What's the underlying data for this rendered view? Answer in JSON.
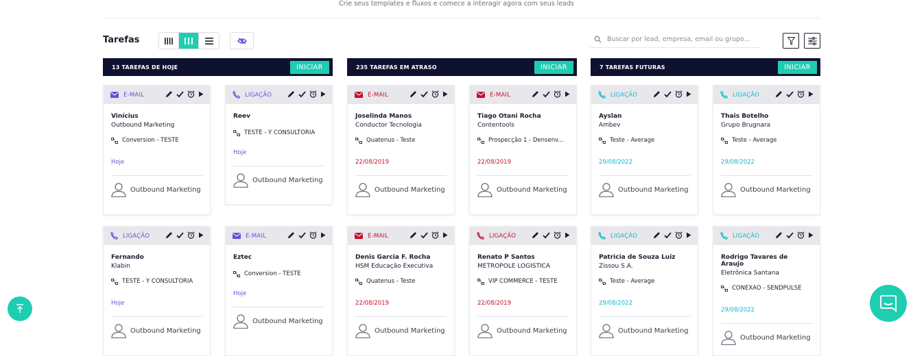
{
  "subtitle": "Crie seus templates e fluxos e comece a interagir agora com seus leads",
  "toolbar": {
    "title": "Tarefas",
    "search_placeholder": "Buscar por lead, empresa, email ou grupo..."
  },
  "colors": {
    "accent": "#1fcdb1",
    "header_bg": "#0f1130",
    "email": "#6a4fd7",
    "overdue": "#c8102e",
    "future": "#12b8c9"
  },
  "columns": [
    {
      "count_label": "13  TAREFAS DE HOJE",
      "start_label": "INICIAR"
    },
    {
      "count_label": "235  TAREFAS EM ATRASO",
      "start_label": "INICIAR"
    },
    {
      "count_label": "7  TAREFAS FUTURAS",
      "start_label": "INICIAR"
    }
  ],
  "cards": [
    {
      "type": "E-MAIL",
      "icon": "mail-icon",
      "lead": "Vinícius",
      "company": "Outbound Marketing",
      "flow": "Conversion - TESTE",
      "due": "Hoje",
      "owner": "Outbound Marketing"
    },
    {
      "type": "LIGAÇÃO",
      "icon": "phone-icon",
      "lead": "Reev",
      "company": "",
      "flow": "TESTE - Y CONSULTORIA",
      "due": "Hoje",
      "owner": "Outbound Marketing"
    },
    {
      "type": "E-MAIL",
      "icon": "mail-icon",
      "lead": "Joselinda Manos",
      "company": "Conductor Tecnologia",
      "flow": "Quatenus - Teste",
      "due": "22/08/2019",
      "owner": "Outbound Marketing"
    },
    {
      "type": "E-MAIL",
      "icon": "mail-icon",
      "lead": "Tiago Otani Rocha",
      "company": "Contentools",
      "flow": "Prospecção 1 - Densenv...",
      "due": "22/08/2019",
      "owner": "Outbound Marketing"
    },
    {
      "type": "LIGAÇÃO",
      "icon": "phone-icon",
      "lead": "Ayslan",
      "company": "Ambev",
      "flow": "Teste - Average",
      "due": "29/08/2022",
      "owner": "Outbound Marketing"
    },
    {
      "type": "LIGAÇÃO",
      "icon": "phone-icon",
      "lead": "Thais Botelho",
      "company": "Grupo Brugnara",
      "flow": "Teste - Average",
      "due": "29/08/2022",
      "owner": "Outbound Marketing"
    },
    {
      "type": "LIGAÇÃO",
      "icon": "phone-icon",
      "lead": "Fernando",
      "company": "Klabin",
      "flow": "TESTE - Y CONSULTORIA",
      "due": "Hoje",
      "owner": "Outbound Marketing"
    },
    {
      "type": "E-MAIL",
      "icon": "mail-icon",
      "lead": "Eztec",
      "company": "",
      "flow": "Conversion - TESTE",
      "due": "Hoje",
      "owner": "Outbound Marketing"
    },
    {
      "type": "E-MAIL",
      "icon": "mail-icon",
      "lead": "Denis Garcia F. Rocha",
      "company": "HSM Educação Executiva",
      "flow": "Quatenus - Teste",
      "due": "22/08/2019",
      "owner": "Outbound Marketing"
    },
    {
      "type": "LIGAÇÃO",
      "icon": "phone-icon",
      "lead": "Renato P Santos",
      "company": "METROPOLE LOGISTICA",
      "flow": "VIP COMMERCE - TESTE",
      "due": "22/08/2019",
      "owner": "Outbound Marketing"
    },
    {
      "type": "LIGAÇÃO",
      "icon": "phone-icon",
      "lead": "Patricia de Souza Luiz",
      "company": "Zissou S.A.",
      "flow": "Teste - Average",
      "due": "29/08/2022",
      "owner": "Outbound Marketing"
    },
    {
      "type": "LIGAÇÃO",
      "icon": "phone-icon",
      "lead": "Rodrigo Tavares de Araujo",
      "company": "Eletrônica Santana",
      "flow": "CONEXÃO - SENDPULSE",
      "due": "29/08/2022",
      "owner": "Outbound Marketing"
    }
  ]
}
